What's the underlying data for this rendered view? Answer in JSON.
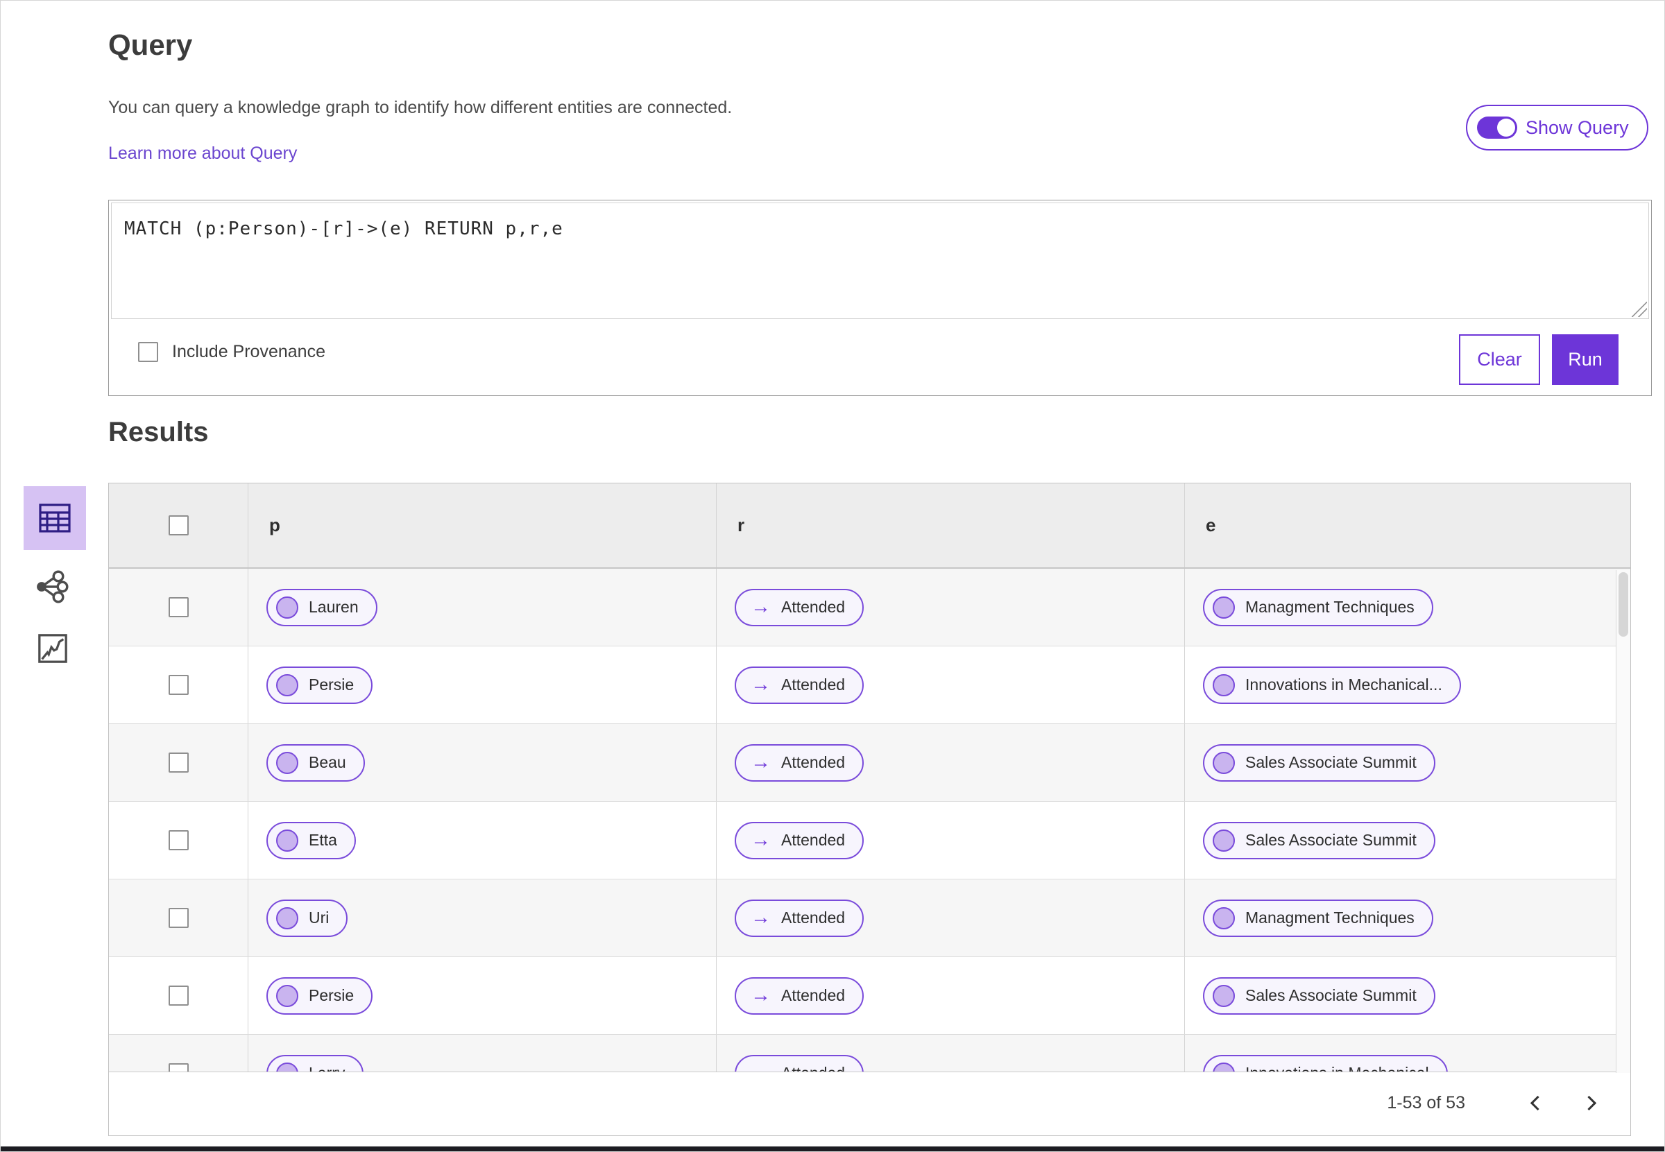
{
  "query": {
    "title": "Query",
    "description": "You can query a knowledge graph to identify how different entities are connected.",
    "learn_more_label": "Learn more about Query",
    "show_query_label": "Show Query",
    "show_query_state": "on",
    "query_text": "MATCH (p:Person)-[r]->(e) RETURN p,r,e",
    "include_provenance_label": "Include Provenance",
    "include_provenance_checked": false,
    "clear_label": "Clear",
    "run_label": "Run"
  },
  "results": {
    "title": "Results",
    "views": [
      {
        "name": "table-view",
        "icon": "table-icon",
        "selected": true
      },
      {
        "name": "graph-view",
        "icon": "network-nodes-icon",
        "selected": false
      },
      {
        "name": "chart-view",
        "icon": "chart-box-icon",
        "selected": false
      }
    ],
    "columns": {
      "p": "p",
      "r": "r",
      "e": "e"
    },
    "relation_arrow": "→",
    "rows": [
      {
        "p": "Lauren",
        "r": "Attended",
        "e": "Managment Techniques"
      },
      {
        "p": "Persie",
        "r": "Attended",
        "e": "Innovations in Mechanical..."
      },
      {
        "p": "Beau",
        "r": "Attended",
        "e": "Sales Associate Summit"
      },
      {
        "p": "Etta",
        "r": "Attended",
        "e": "Sales Associate Summit"
      },
      {
        "p": "Uri",
        "r": "Attended",
        "e": "Managment Techniques"
      },
      {
        "p": "Persie",
        "r": "Attended",
        "e": "Sales Associate Summit"
      },
      {
        "p": "Larry",
        "r": "Attended",
        "e": "Innovations in Mechanical"
      }
    ],
    "pagination": {
      "range": "1-53 of 53",
      "prev_icon": "chevron-left",
      "next_icon": "chevron-right"
    }
  },
  "colors": {
    "accent_purple": "#6d35d8",
    "pill_border": "#7a4bdb",
    "pill_background": "#f7f5fd",
    "node_fill": "#c9b4ef",
    "selected_tile_background": "#d6c2f3",
    "link": "#6b46cf",
    "header_row_background": "#ededed",
    "alt_row_background": "#f6f6f6"
  }
}
